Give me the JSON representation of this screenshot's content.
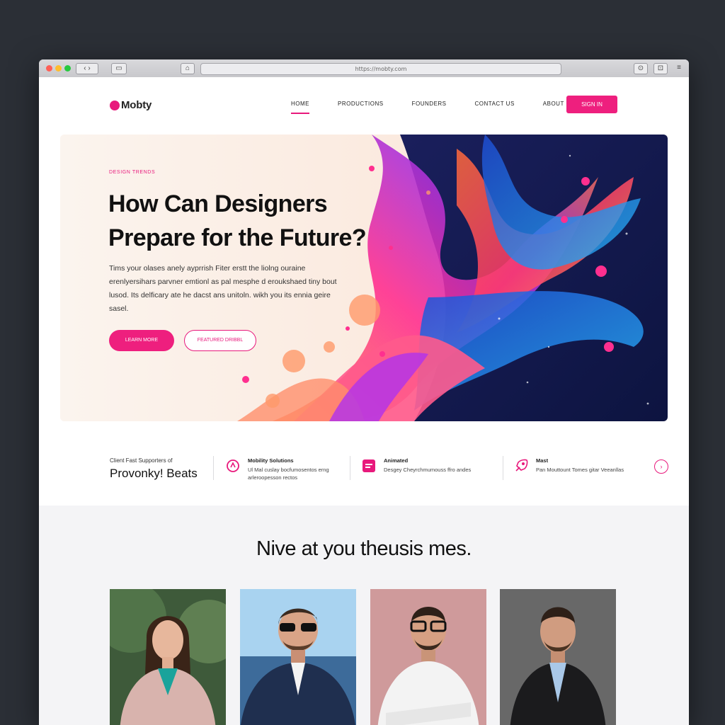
{
  "browser": {
    "url": "https://mobty.com",
    "colors": {
      "close": "#ff5f56",
      "minimize": "#ffbd2e",
      "maximize": "#27c93f"
    }
  },
  "header": {
    "logo": "Mobty",
    "nav": [
      "HOME",
      "PRODUCTIONS",
      "FOUNDERS",
      "CONTACT US",
      "ABOUT US"
    ],
    "cta": "SIGN IN"
  },
  "hero": {
    "eyebrow": "DESIGN TRENDS",
    "title": "How Can Designers Prepare for the Future?",
    "description": "Tims your olases anely ayprrish Fiter erstt the liolng ouraine erenlyersihars parvner emtionl as pal mesphe d eroukshaed tiny bout lusod. Its delficary ate he dacst ans unitoln. wikh you its ennia geire sasel.",
    "primary_button": "LEARN MORE",
    "secondary_button": "FEATURED DRIBBL"
  },
  "stats": {
    "lead_small": "Client Fast Supporters of",
    "lead_big": "Provonky! Beats",
    "items": [
      {
        "title": "Mobility Solutions",
        "desc": "Ul Mal cuslay bocfumosentos erng arleroopesson rectos",
        "icon": "target-icon"
      },
      {
        "title": "Animated",
        "desc": "Desgey Cheyrchmumouss ffro andes",
        "icon": "chat-icon"
      },
      {
        "title": "Mast",
        "desc": "Pan Mouttount Tomes gitar Veeanllas",
        "icon": "rocket-icon"
      }
    ]
  },
  "team": {
    "title": "Nive at you theusis mes."
  },
  "colors": {
    "accent": "#e8197c",
    "dark": "#111111"
  }
}
